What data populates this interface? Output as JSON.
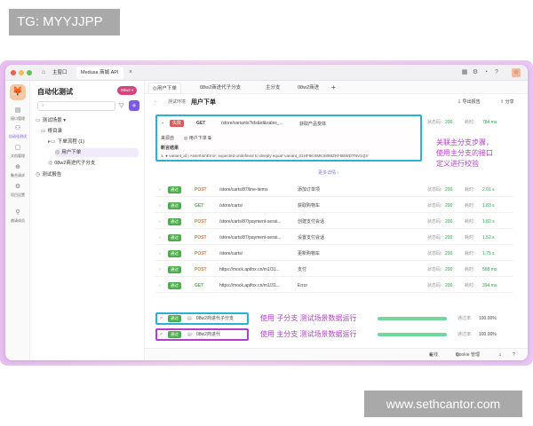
{
  "overlay": {
    "tag": "TG: MYYJJPP",
    "watermark": "www.sethcantor.com"
  },
  "window": {
    "tabs": [
      "主窗口",
      "Medusa 商城 API"
    ],
    "close_icon": "×"
  },
  "rail": [
    {
      "label": "接口管理",
      "icon": "api-icon"
    },
    {
      "label": "自动化测试",
      "icon": "flow-icon",
      "active": true
    },
    {
      "label": "文档管理",
      "icon": "doc-icon"
    },
    {
      "label": "聚合请求",
      "icon": "merge-icon"
    },
    {
      "label": "项目设置",
      "icon": "settings-icon"
    },
    {
      "label": "邀请成员",
      "icon": "invite-icon"
    }
  ],
  "sidebar": {
    "title": "自动化测试",
    "badge": "08w2 ▾",
    "search_placeholder": "",
    "tree": [
      {
        "label": "测试场景 ▾",
        "level": 0
      },
      {
        "label": "根目录",
        "level": 1
      },
      {
        "label": "下单流程 (1)",
        "level": 2
      },
      {
        "label": "用户下单",
        "level": 3,
        "selected": true
      },
      {
        "label": "08w2商进代子分支",
        "level": 2
      },
      {
        "label": "测试报告",
        "level": 0
      }
    ]
  },
  "main": {
    "tabs": [
      "用户下单",
      "08w2商进代子分支",
      "主分支",
      "08w2商进"
    ],
    "add_tab": "+",
    "breadcrumb": "测试环境",
    "title": "用户下单",
    "export": "导出报告",
    "share": "分享",
    "error": {
      "status": "失败",
      "method": "GET",
      "path": "/store/variants?ids&id&sales_...",
      "desc": "获取产品变体",
      "code_label": "状态码:",
      "code": "200",
      "time_label": "耗时:",
      "time": "784 ms",
      "source_label": "来源自",
      "source": "用户下单",
      "assert_title": "断言结果",
      "assert_text": "1. ● variant_id | AssertionError: expected undefined to deeply equal 'variant_01HF8KSMKS898ZKF6BWDTNV1Q4'"
    },
    "more": "更多详情 ›",
    "rows": [
      {
        "status": "通过",
        "method": "POST",
        "path": "/store/carts/87/line-items",
        "desc": "添加订单项",
        "code": "200",
        "time": "2.01 s"
      },
      {
        "status": "通过",
        "method": "GET",
        "path": "/store/carts/",
        "desc": "获取购物车",
        "code": "200",
        "time": "1.83 s"
      },
      {
        "status": "通过",
        "method": "POST",
        "path": "/store/carts/87/payment-sessi...",
        "desc": "创建支付会话",
        "code": "200",
        "time": "1.82 s"
      },
      {
        "status": "通过",
        "method": "POST",
        "path": "/store/carts/87/payment-sessi...",
        "desc": "设置支付会话",
        "code": "200",
        "time": "1.52 s"
      },
      {
        "status": "通过",
        "method": "POST",
        "path": "/store/carts/",
        "desc": "更新购物车",
        "code": "200",
        "time": "1.75 s"
      },
      {
        "status": "通过",
        "method": "POST",
        "path": "https://mock.apifox.cn/m1/31...",
        "desc": "支付",
        "code": "200",
        "time": "568 ms"
      },
      {
        "status": "通过",
        "method": "GET",
        "path": "https://mock.apifox.cn/m1/31...",
        "desc": "Error",
        "code": "200",
        "time": "394 ms"
      }
    ],
    "branch_rows": [
      {
        "status": "通过",
        "name": "08w2商进代子分支",
        "annot": "使用 子分支 测试场景数据运行",
        "pass_label": "通过率:",
        "pass": "100.00%",
        "progress": 1.0
      },
      {
        "status": "通过",
        "name": "08w2商进代",
        "annot": "使用 主分支 测试场景数据运行",
        "pass_label": "通过率:",
        "pass": "100.00%",
        "progress": 1.0
      }
    ],
    "annotation": [
      "关联主分支步骤，",
      "使用主分支的接口",
      "定义进行校验"
    ],
    "footer": {
      "online": "在线",
      "cookie": "Cookie 管理"
    }
  }
}
